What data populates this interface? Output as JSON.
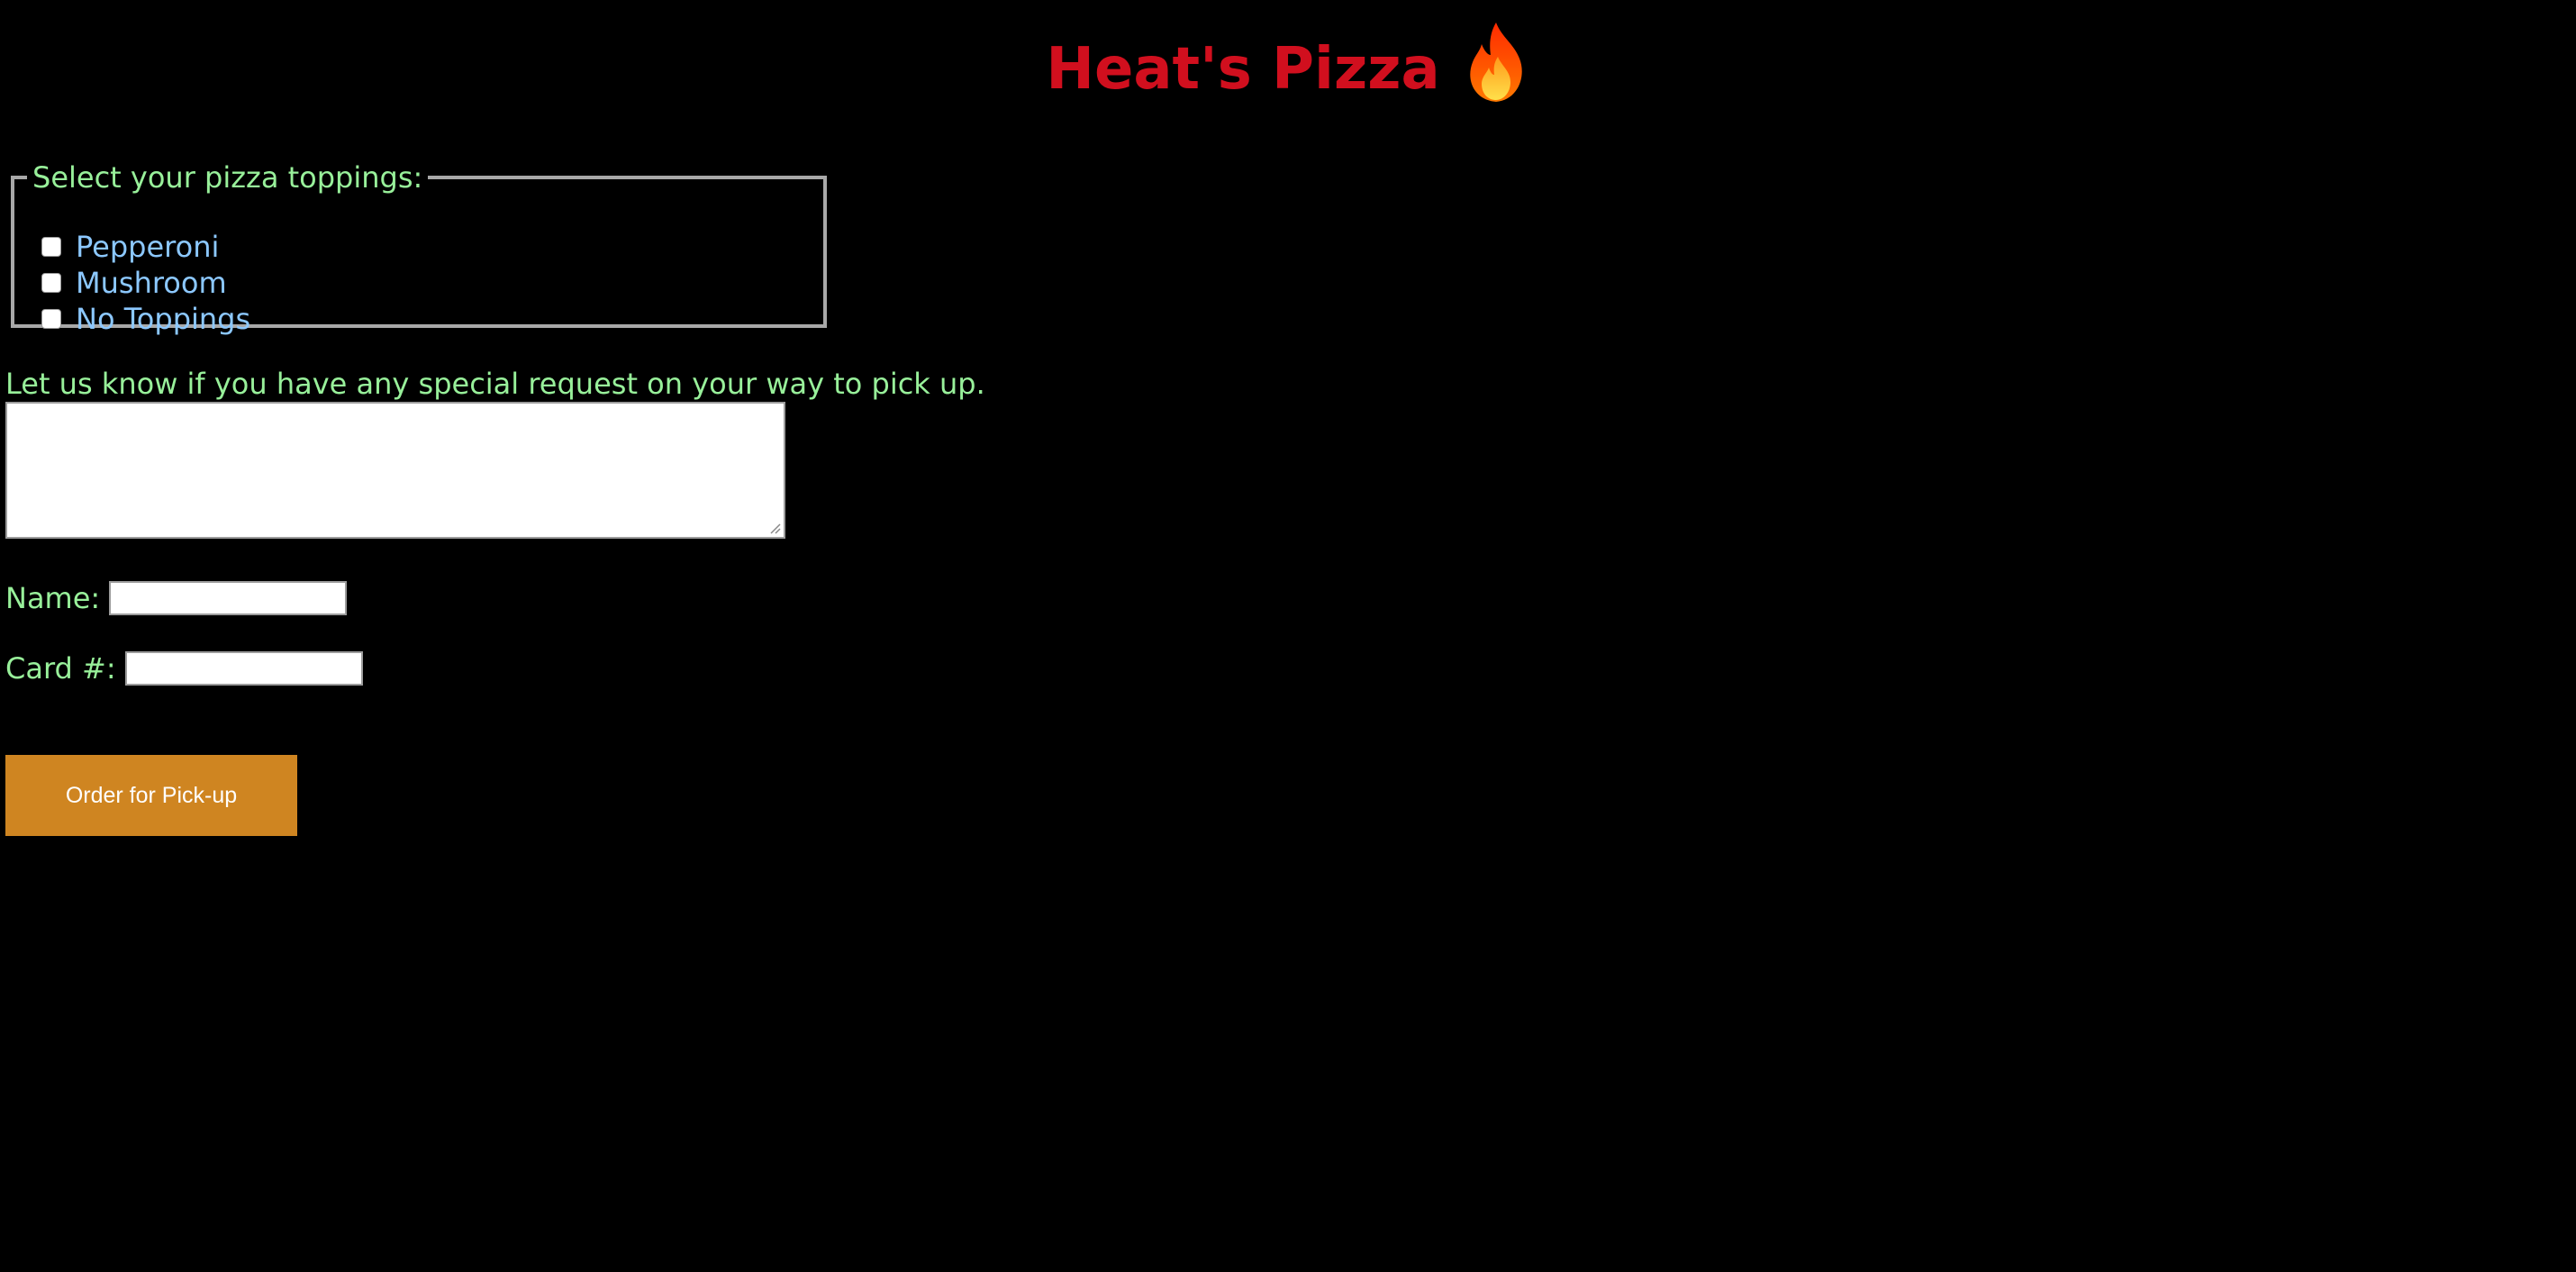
{
  "header": {
    "title": "Heat's Pizza",
    "icon": "fire-icon",
    "title_color": "#d10f1e"
  },
  "toppings": {
    "legend": "Select your pizza toppings:",
    "options": [
      {
        "label": "Pepperoni",
        "checked": false
      },
      {
        "label": "Mushroom",
        "checked": false
      },
      {
        "label": "No Toppings",
        "checked": false
      }
    ]
  },
  "special_request": {
    "label": "Let us know if you have any special request on your way to pick up.",
    "value": ""
  },
  "form": {
    "name_label": "Name:",
    "name_value": "",
    "card_label": "Card #:",
    "card_value": ""
  },
  "submit": {
    "label": "Order for Pick-up",
    "color": "#cf8521"
  },
  "colors": {
    "background": "#000000",
    "label_green": "#98f09a",
    "option_blue": "#8cc8ff"
  }
}
